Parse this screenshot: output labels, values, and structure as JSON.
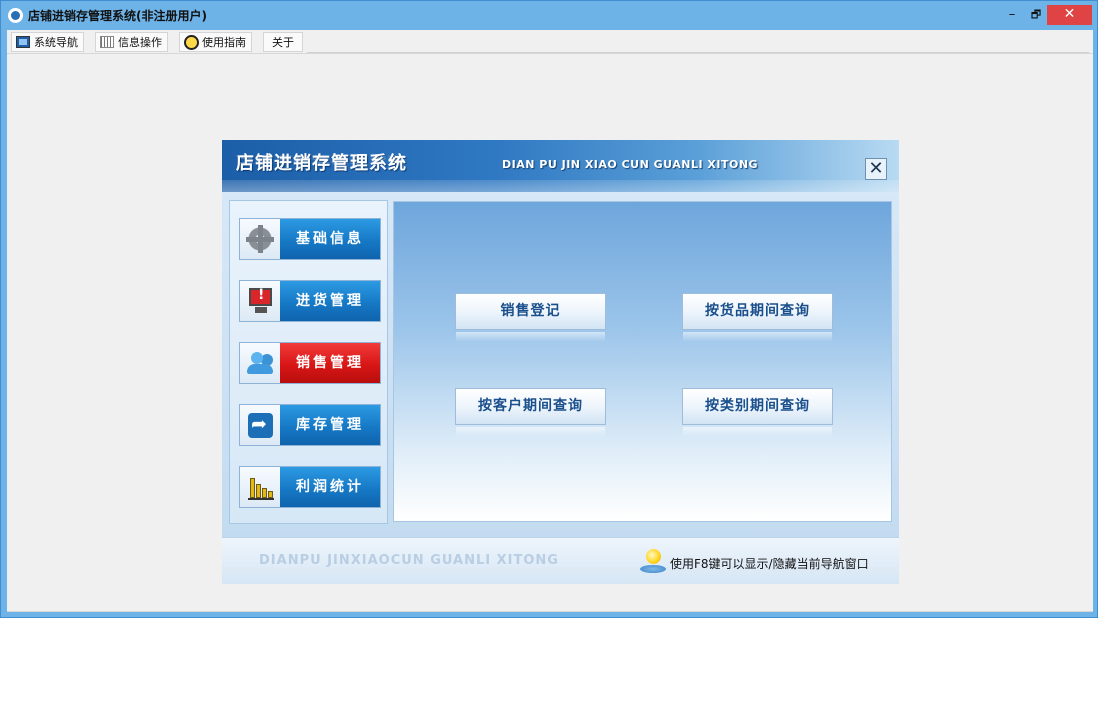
{
  "window": {
    "title": "店铺进销存管理系统(非注册用户)",
    "controls": {
      "minimize": "–",
      "restore": "🗗",
      "close": "✕"
    }
  },
  "menubar": {
    "items": [
      {
        "label": "系统导航",
        "icon": "monitor-icon"
      },
      {
        "label": "信息操作",
        "icon": "grid-icon"
      },
      {
        "label": "使用指南",
        "icon": "clock-icon"
      },
      {
        "label": "关于",
        "icon": ""
      }
    ]
  },
  "nav_dialog": {
    "title": "店铺进销存管理系统",
    "subtitle": "DIAN PU JIN XIAO CUN GUANLI XITONG",
    "close_glyph": "✕",
    "side_buttons": [
      {
        "label": "基础信息",
        "icon": "gear-icon",
        "active": false
      },
      {
        "label": "进货管理",
        "icon": "alert-monitor-icon",
        "active": false
      },
      {
        "label": "销售管理",
        "icon": "users-icon",
        "active": true
      },
      {
        "label": "库存管理",
        "icon": "arrow-icon",
        "active": false
      },
      {
        "label": "利润统计",
        "icon": "bar-chart-icon",
        "active": false
      }
    ],
    "actions": [
      {
        "label": "销售登记"
      },
      {
        "label": "按货品期间查询"
      },
      {
        "label": "按客户期间查询"
      },
      {
        "label": "按类别期间查询"
      }
    ],
    "footer": {
      "brand": "DIANPU JINXIAOCUN GUANLI XITONG",
      "hint": "使用F8键可以显示/隐藏当前导航窗口",
      "hint_icon": "lightbulb-icon"
    }
  },
  "colors": {
    "title_bar": "#6db3e8",
    "close_button": "#e04343",
    "side_button_blue": "#1679c6",
    "side_button_active": "#d81616",
    "action_text": "#1a4f8c"
  }
}
